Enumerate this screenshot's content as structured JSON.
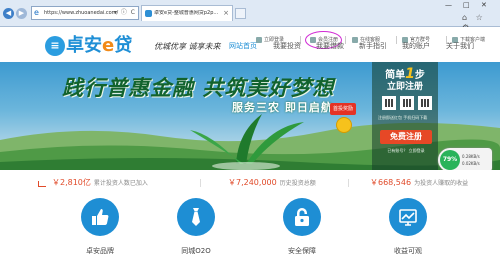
{
  "browser": {
    "url": "https://www.zhuoanedai.com/",
    "tab_title": "卓安e贷-整城普惠网贷p2p...",
    "tab_close": "×",
    "address_tools": "▾ ⓘ C",
    "window_controls": {
      "minimize": "—",
      "maximize": "□",
      "close": "✕"
    },
    "toolbar_icons": "⌂ ☆ ⚙"
  },
  "topbar": {
    "links": [
      "立即登录",
      "会员注册",
      "在线客服",
      "官方群号",
      "下载客户端"
    ]
  },
  "header": {
    "logo_text": "卓安",
    "logo_e": "e",
    "logo_tail": "贷",
    "logo_mark": "≡",
    "slogan": "优城优享 诚享未来",
    "nav": [
      "网站首页",
      "我要投资",
      "我要借款",
      "新手指引",
      "我的账户",
      "关于我们"
    ],
    "active_index": 0
  },
  "banner": {
    "headline": "践行普惠金融 共筑美好梦想",
    "sub": "服务三农 即日启航",
    "badge": "首投奖励",
    "register_box": {
      "line1_pre": "简单",
      "line1_num": "1",
      "line1_post": "步",
      "line2": "立即注册",
      "info": "注册即送红包 手机扫码下载",
      "button": "免费注册",
      "login": "已有账号？ 立即登录"
    },
    "widget": {
      "circle": "79%",
      "line1": "0.28KB/s",
      "line2": "0.02KB/s"
    }
  },
  "stats": [
    {
      "value": "￥2,810亿",
      "label": "累计投资人数已加入"
    },
    {
      "value": "￥7,240,000",
      "label": "历史投资总额"
    },
    {
      "value": "￥668,546",
      "label": "为投资人赚取的收益"
    }
  ],
  "features": [
    {
      "label": "卓安品牌",
      "icon": "thumbs-up-icon"
    },
    {
      "label": "同城O2O",
      "icon": "tie-icon"
    },
    {
      "label": "安全保障",
      "icon": "lock-icon"
    },
    {
      "label": "收益可观",
      "icon": "chart-icon"
    }
  ],
  "colors": {
    "brand_blue": "#1f8fd6",
    "accent_orange": "#f28a18",
    "stat_red": "#e14b2a",
    "highlight_ring": "#d12bd5"
  }
}
